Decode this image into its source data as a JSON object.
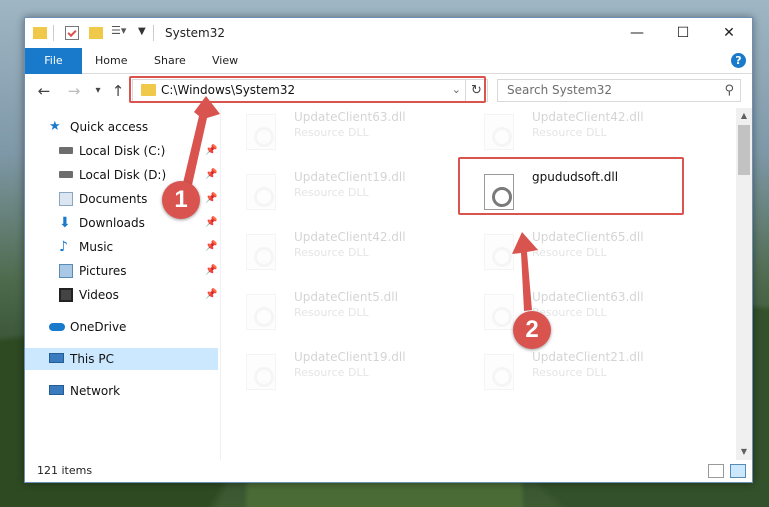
{
  "window": {
    "title": "System32",
    "controls": {
      "minimize": "—",
      "maximize": "☐",
      "close": "✕"
    }
  },
  "ribbon": {
    "tabs": [
      "File",
      "Home",
      "Share",
      "View"
    ],
    "help": "?"
  },
  "nav": {
    "back": "←",
    "forward": "→",
    "recent": "▾",
    "up": "↑",
    "address": "C:\\Windows\\System32",
    "search_placeholder": "Search System32"
  },
  "sidebar": {
    "items": [
      {
        "label": "Quick access",
        "icon": "star-icon",
        "color": "#1979ca"
      },
      {
        "label": "Local Disk (C:)",
        "icon": "drive-icon",
        "color": "#6d6d6d"
      },
      {
        "label": "Local Disk (D:)",
        "icon": "drive-icon",
        "color": "#6d6d6d"
      },
      {
        "label": "Documents",
        "icon": "documents-icon",
        "color": "#8aa6c1"
      },
      {
        "label": "Downloads",
        "icon": "downloads-icon",
        "color": "#1979ca"
      },
      {
        "label": "Music",
        "icon": "music-icon",
        "color": "#1979ca"
      },
      {
        "label": "Pictures",
        "icon": "pictures-icon",
        "color": "#5a8bb5"
      },
      {
        "label": "Videos",
        "icon": "videos-icon",
        "color": "#444444"
      },
      {
        "label": "OneDrive",
        "icon": "onedrive-icon",
        "color": "#1979ca"
      },
      {
        "label": "This PC",
        "icon": "computer-icon",
        "color": "#3a7bbf"
      },
      {
        "label": "Network",
        "icon": "network-icon",
        "color": "#3a7bbf"
      }
    ]
  },
  "files": [
    {
      "name": "UpdateClient63.dll",
      "type": "Resource DLL"
    },
    {
      "name": "UpdateClient42.dll",
      "type": "Resource DLL"
    },
    {
      "name": "UpdateClient19.dll",
      "type": "Resource DLL"
    },
    {
      "name": "gpududsoft.dll",
      "type": ""
    },
    {
      "name": "UpdateClient42.dll",
      "type": "Resource DLL"
    },
    {
      "name": "UpdateClient65.dll",
      "type": "Resource DLL"
    },
    {
      "name": "UpdateClient5.dll",
      "type": "Resource DLL"
    },
    {
      "name": "UpdateClient63.dll",
      "type": "Resource DLL"
    },
    {
      "name": "UpdateClient19.dll",
      "type": "Resource DLL"
    },
    {
      "name": "UpdateClient21.dll",
      "type": "Resource DLL"
    }
  ],
  "status": {
    "item_count": "121 items"
  },
  "annotations": {
    "step1": "1",
    "step2": "2",
    "color": "#d9534f"
  }
}
